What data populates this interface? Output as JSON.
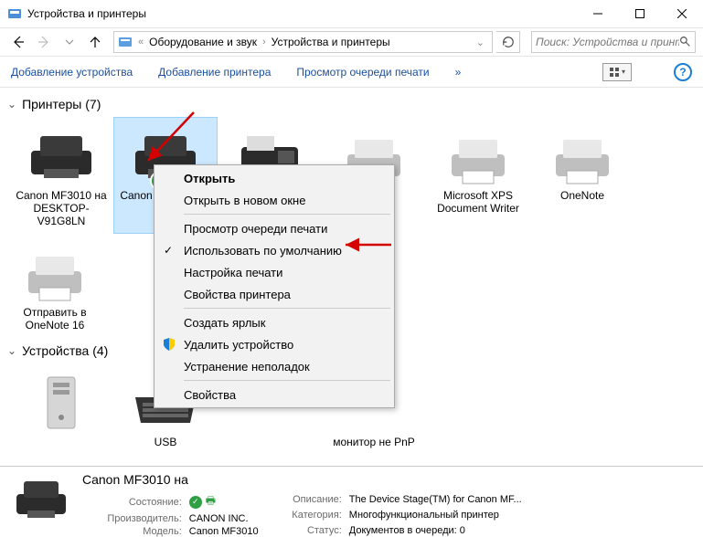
{
  "window": {
    "title": "Устройства и принтеры"
  },
  "breadcrumb": {
    "item1": "Оборудование и звук",
    "item2": "Устройства и принтеры"
  },
  "search": {
    "placeholder": "Поиск: Устройства и принте..."
  },
  "toolbar": {
    "add_device": "Добавление устройства",
    "add_printer": "Добавление принтера",
    "view_queue": "Просмотр очереди печати",
    "chevrons": "»"
  },
  "groups": {
    "printers": {
      "title": "Принтеры (7)"
    },
    "devices": {
      "title": "Устройства (4)"
    }
  },
  "printers": [
    {
      "label": "Canon MF3010 на DESKTOP-V91G8LN"
    },
    {
      "label": "Canon MF3010 на M"
    },
    {
      "label": ""
    },
    {
      "label": ""
    },
    {
      "label": "Microsoft XPS Document Writer"
    },
    {
      "label": "OneNote"
    },
    {
      "label": "Отправить в OneNote 16"
    }
  ],
  "devices": [
    {
      "label": ""
    },
    {
      "label": "USB"
    },
    {
      "label": ""
    },
    {
      "label": "монитор не PnP"
    }
  ],
  "context_menu": {
    "open": "Открыть",
    "open_new": "Открыть в новом окне",
    "queue": "Просмотр очереди печати",
    "set_default": "Использовать по умолчанию",
    "print_settings": "Настройка печати",
    "printer_props": "Свойства принтера",
    "create_shortcut": "Создать ярлык",
    "delete_device": "Удалить устройство",
    "troubleshoot": "Устранение неполадок",
    "properties": "Свойства"
  },
  "details": {
    "title": "Canon MF3010 на",
    "labels": {
      "state": "Состояние:",
      "manufacturer": "Производитель:",
      "model": "Модель:",
      "description": "Описание:",
      "category": "Категория:",
      "status": "Статус:"
    },
    "values": {
      "manufacturer": "CANON INC.",
      "model": "Canon MF3010",
      "description": "The Device Stage(TM) for Canon MF...",
      "category": "Многофункциональный принтер",
      "status": "Документов в очереди: 0"
    }
  }
}
